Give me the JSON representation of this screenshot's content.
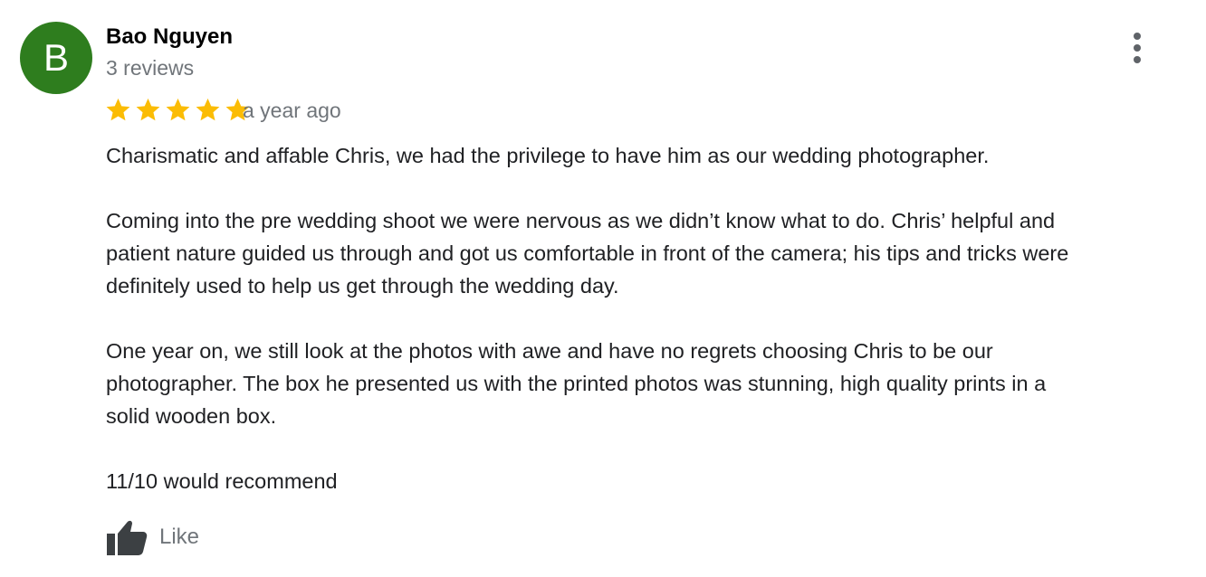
{
  "review": {
    "avatar_initial": "B",
    "avatar_color": "#2e7d1e",
    "author_name": "Bao Nguyen",
    "review_count": "3 reviews",
    "rating": 5,
    "rating_max": 5,
    "star_color": "#fbbc04",
    "date": "a year ago",
    "paragraphs": [
      "Charismatic and affable Chris, we had the privilege to have him as our wedding photographer.",
      "Coming into the pre wedding shoot we were nervous as we didn’t know what to do. Chris’ helpful and\npatient nature guided us through and got us comfortable in front of the camera; his tips and tricks were\ndefinitely used to help us get through the wedding day.",
      "One year on, we still look at the photos with awe and have no regrets choosing Chris to be our\nphotographer. The box he presented us with the printed photos was stunning, high quality prints in a\nsolid wooden box.",
      "11/10 would recommend"
    ],
    "like_label": "Like",
    "menu_icon": "more-vert-icon",
    "like_icon": "thumb-up-icon"
  }
}
